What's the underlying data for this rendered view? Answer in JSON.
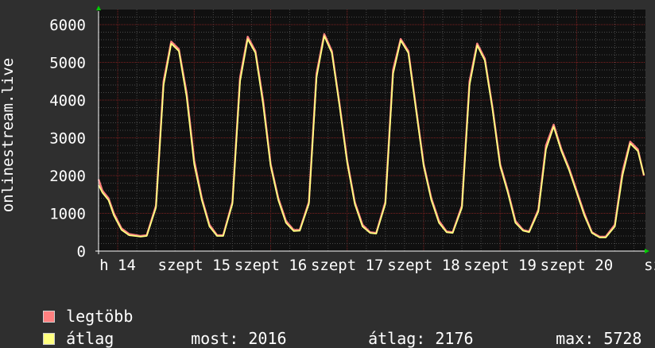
{
  "y_axis_title": "onlinestream.live",
  "legend": [
    {
      "label": "legtöbb",
      "color": "#ff8080"
    },
    {
      "label": "átlag",
      "color": "#ffff80"
    }
  ],
  "stats": {
    "most_label": "most:",
    "most_value": "2016",
    "atlag_label": "átlag:",
    "atlag_value": "2176",
    "max_label": "max:",
    "max_value": "5728"
  },
  "chart_data": {
    "type": "line",
    "ylim": [
      0,
      6400
    ],
    "y_ticks": [
      0,
      1000,
      2000,
      3000,
      4000,
      5000,
      6000
    ],
    "x_tick_labels": [
      "h 14",
      "szept 15",
      "szept 16",
      "szept 17",
      "szept 18",
      "szept 19",
      "szept 20",
      "sz"
    ],
    "x_day_range": [
      -0.25,
      6.9
    ],
    "grid": true,
    "series": [
      {
        "name": "legtöbb",
        "color": "#ff8080",
        "x": [
          -0.25,
          -0.2,
          -0.12,
          -0.05,
          0.05,
          0.15,
          0.3,
          0.38,
          0.5,
          0.6,
          0.7,
          0.8,
          0.9,
          1.0,
          1.1,
          1.2,
          1.3,
          1.38,
          1.5,
          1.6,
          1.7,
          1.8,
          1.9,
          2.0,
          2.1,
          2.2,
          2.3,
          2.38,
          2.5,
          2.6,
          2.7,
          2.8,
          2.9,
          3.0,
          3.1,
          3.2,
          3.3,
          3.38,
          3.5,
          3.6,
          3.7,
          3.8,
          3.9,
          4.0,
          4.1,
          4.2,
          4.3,
          4.38,
          4.5,
          4.6,
          4.7,
          4.8,
          4.9,
          5.0,
          5.1,
          5.2,
          5.3,
          5.38,
          5.5,
          5.6,
          5.7,
          5.8,
          5.9,
          6.0,
          6.1,
          6.2,
          6.3,
          6.38,
          6.5,
          6.6,
          6.7,
          6.8,
          6.88
        ],
        "values": [
          1900,
          1600,
          1400,
          1000,
          600,
          450,
          400,
          420,
          1200,
          4500,
          5550,
          5350,
          4200,
          2400,
          1400,
          700,
          420,
          420,
          1300,
          4600,
          5680,
          5300,
          4000,
          2300,
          1400,
          800,
          560,
          560,
          1300,
          4700,
          5750,
          5300,
          3900,
          2400,
          1300,
          700,
          500,
          480,
          1300,
          4800,
          5620,
          5300,
          3800,
          2300,
          1400,
          800,
          520,
          500,
          1200,
          4500,
          5500,
          5100,
          3800,
          2300,
          1600,
          800,
          560,
          520,
          1100,
          2800,
          3350,
          2700,
          2200,
          1600,
          1000,
          500,
          380,
          380,
          700,
          2100,
          2900,
          2700,
          2000
        ]
      },
      {
        "name": "átlag",
        "color": "#ffff80",
        "x": [
          -0.25,
          -0.2,
          -0.12,
          -0.05,
          0.05,
          0.15,
          0.3,
          0.38,
          0.5,
          0.6,
          0.7,
          0.8,
          0.9,
          1.0,
          1.1,
          1.2,
          1.3,
          1.38,
          1.5,
          1.6,
          1.7,
          1.8,
          1.9,
          2.0,
          2.1,
          2.2,
          2.3,
          2.38,
          2.5,
          2.6,
          2.7,
          2.8,
          2.9,
          3.0,
          3.1,
          3.2,
          3.3,
          3.38,
          3.5,
          3.6,
          3.7,
          3.8,
          3.9,
          4.0,
          4.1,
          4.2,
          4.3,
          4.38,
          4.5,
          4.6,
          4.7,
          4.8,
          4.9,
          5.0,
          5.1,
          5.2,
          5.3,
          5.38,
          5.5,
          5.6,
          5.7,
          5.8,
          5.9,
          6.0,
          6.1,
          6.2,
          6.3,
          6.38,
          6.5,
          6.6,
          6.7,
          6.8,
          6.88
        ],
        "values": [
          1750,
          1550,
          1350,
          950,
          560,
          420,
          380,
          400,
          1150,
          4400,
          5500,
          5300,
          4100,
          2300,
          1350,
          650,
          400,
          400,
          1250,
          4500,
          5620,
          5250,
          3900,
          2250,
          1350,
          750,
          530,
          540,
          1250,
          4600,
          5700,
          5250,
          3850,
          2350,
          1250,
          650,
          480,
          460,
          1250,
          4700,
          5580,
          5250,
          3750,
          2250,
          1350,
          750,
          500,
          480,
          1150,
          4400,
          5450,
          5050,
          3750,
          2250,
          1550,
          750,
          540,
          500,
          1050,
          2700,
          3300,
          2650,
          2150,
          1550,
          950,
          480,
          360,
          360,
          650,
          2000,
          2850,
          2650,
          2016
        ]
      }
    ]
  }
}
